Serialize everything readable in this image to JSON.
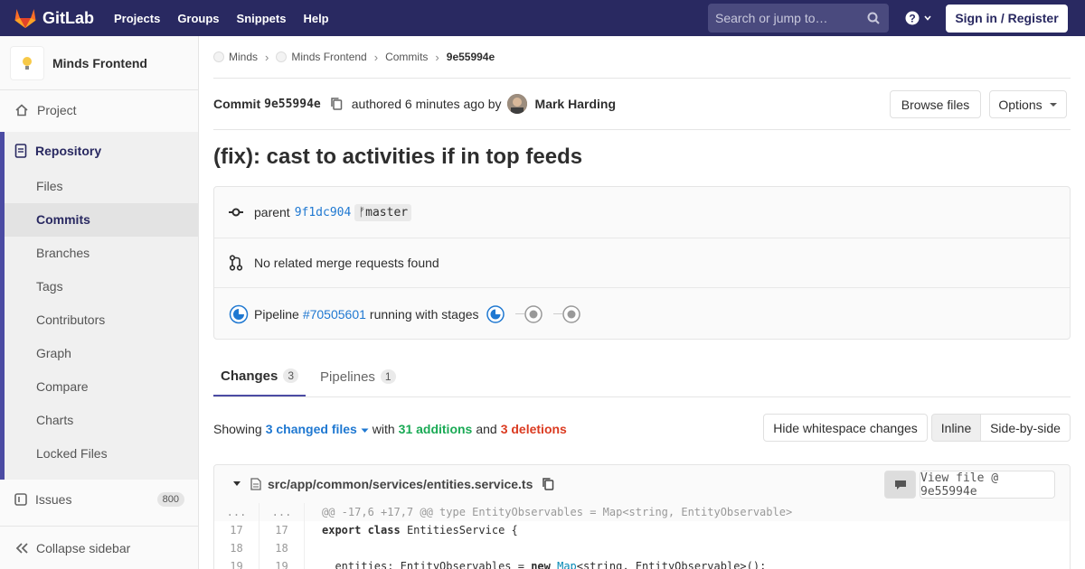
{
  "topbar": {
    "brand": "GitLab",
    "nav": [
      "Projects",
      "Groups",
      "Snippets",
      "Help"
    ],
    "search_placeholder": "Search or jump to…",
    "sign_in": "Sign in / Register"
  },
  "sidebar": {
    "project_name": "Minds Frontend",
    "project": "Project",
    "repository": "Repository",
    "repo_items": [
      "Files",
      "Commits",
      "Branches",
      "Tags",
      "Contributors",
      "Graph",
      "Compare",
      "Charts",
      "Locked Files"
    ],
    "issues": "Issues",
    "issues_count": "800",
    "collapse": "Collapse sidebar"
  },
  "breadcrumbs": [
    "Minds",
    "Minds Frontend",
    "Commits",
    "9e55994e"
  ],
  "commit": {
    "label": "Commit",
    "sha": "9e55994e",
    "authored": "authored 6 minutes ago by",
    "author": "Mark Harding",
    "browse_files": "Browse files",
    "options": "Options",
    "title": "(fix): cast to activities if in top feeds",
    "parent_label": "parent",
    "parent_sha": "9f1dc904",
    "branch": "master",
    "merge_requests": "No related merge requests found",
    "pipeline_label": "Pipeline",
    "pipeline_id": "#70505601",
    "pipeline_status": "running with stages"
  },
  "tabs": [
    {
      "label": "Changes",
      "count": "3"
    },
    {
      "label": "Pipelines",
      "count": "1"
    }
  ],
  "summary": {
    "showing": "Showing",
    "files": "3 changed files",
    "with": "with",
    "additions": "31 additions",
    "and": "and",
    "deletions": "3 deletions",
    "hide_whitespace": "Hide whitespace changes",
    "inline": "Inline",
    "side_by_side": "Side-by-side"
  },
  "file": {
    "path": "src/app/common/services/entities.service.ts",
    "view_file": "View file @ 9e55994e"
  },
  "diff": [
    {
      "old": "...",
      "new": "...",
      "text": "@@ -17,6 +17,7 @@ type EntityObservables = Map<string, EntityObservable>"
    },
    {
      "old": "17",
      "new": "17",
      "text": "export class EntitiesService {"
    },
    {
      "old": "18",
      "new": "18",
      "text": ""
    },
    {
      "old": "19",
      "new": "19",
      "text": "  entities: EntityObservables = new Map<string, EntityObservable>();"
    }
  ]
}
